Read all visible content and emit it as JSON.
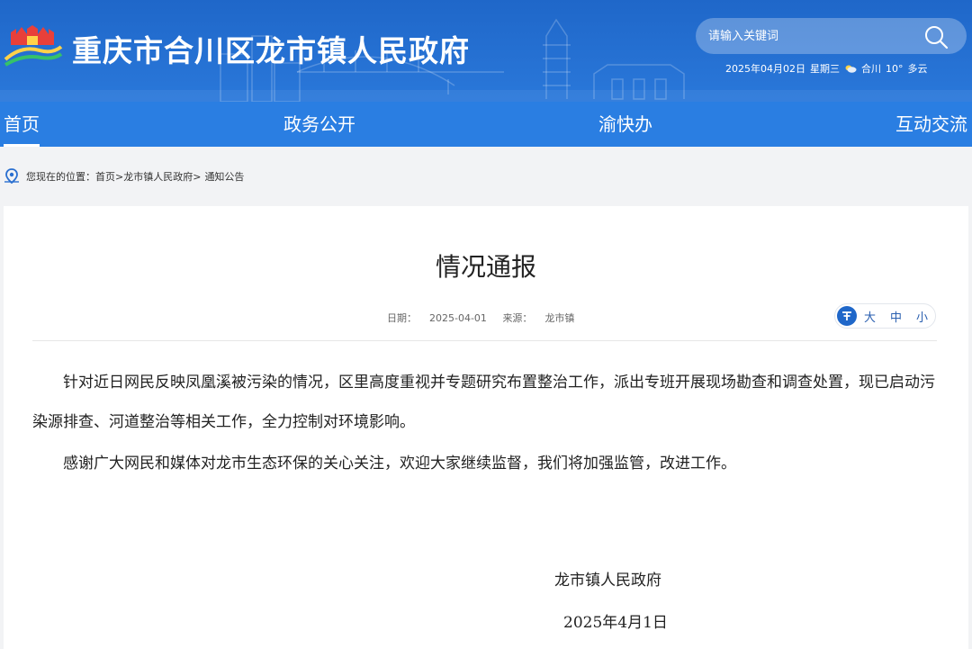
{
  "header": {
    "site_title": "重庆市合川区龙市镇人民政府",
    "search_placeholder": "请输入关键词",
    "date": "2025年04月02日",
    "weekday": "星期三",
    "location": "合川",
    "temperature": "10°",
    "weather": "多云",
    "colors": {
      "header_bg": "#2173d6",
      "nav_bg": "#2a7ee2"
    }
  },
  "nav": {
    "items": [
      {
        "label": "首页",
        "active": true
      },
      {
        "label": "政务公开",
        "active": false
      },
      {
        "label": "渝快办",
        "active": false
      },
      {
        "label": "互动交流",
        "active": false
      }
    ]
  },
  "breadcrumb": {
    "prefix": "您现在的位置：",
    "items": [
      "首页",
      "龙市镇人民政府",
      "通知公告"
    ],
    "separator": ">"
  },
  "article": {
    "title": "情况通报",
    "date_label": "日期：",
    "date": "2025-04-01",
    "source_label": "来源：",
    "source": "龙市镇",
    "font_size_options": [
      "大",
      "中",
      "小"
    ],
    "paragraphs": [
      "针对近日网民反映凤凰溪被污染的情况，区里高度重视并专题研究布置整治工作，派出专班开展现场勘查和调查处置，现已启动污染源排查、河道整治等相关工作，全力控制对环境影响。",
      "感谢广大网民和媒体对龙市生态环保的关心关注，欢迎大家继续监督，我们将加强监管，改进工作。"
    ],
    "signature_org": "龙市镇人民政府",
    "signature_date": "2025年4月1日"
  }
}
